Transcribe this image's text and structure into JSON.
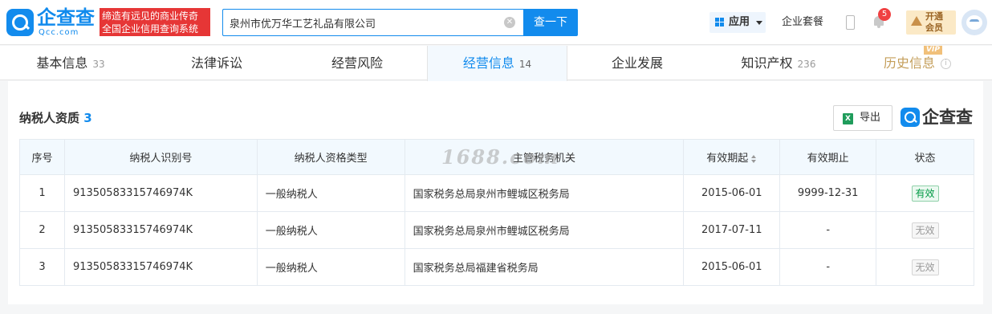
{
  "header": {
    "logo": {
      "name": "企查查",
      "domain": "Qcc.com"
    },
    "slogan": [
      "缔造有远见的商业传奇",
      "全国企业信用查询系统"
    ],
    "search": {
      "value": "泉州市优万华工艺礼品有限公司",
      "button": "查一下"
    },
    "apps_label": "应用",
    "suite_label": "企业套餐",
    "notification_count": "5",
    "vip": {
      "line1": "开通",
      "line2": "会员"
    }
  },
  "tabs": [
    {
      "label": "基本信息",
      "count": "33"
    },
    {
      "label": "法律诉讼",
      "count": ""
    },
    {
      "label": "经营风险",
      "count": ""
    },
    {
      "label": "经营信息",
      "count": "14",
      "active": true
    },
    {
      "label": "企业发展",
      "count": ""
    },
    {
      "label": "知识产权",
      "count": "236"
    },
    {
      "label": "历史信息",
      "count": "",
      "tag": "VIP"
    }
  ],
  "section": {
    "title": "纳税人资质",
    "count": "3",
    "export_label": "导出",
    "brand": "企查查"
  },
  "table": {
    "headers": [
      "序号",
      "纳税人识别号",
      "纳税人资格类型",
      "主管税务机关",
      "有效期起",
      "有效期止",
      "状态"
    ],
    "rows": [
      {
        "no": "1",
        "tax_id": "91350583315746974K",
        "type": "一般纳税人",
        "authority": "国家税务总局泉州市鲤城区税务局",
        "start": "2015-06-01",
        "end": "9999-12-31",
        "status": "有效",
        "valid": true
      },
      {
        "no": "2",
        "tax_id": "91350583315746974K",
        "type": "一般纳税人",
        "authority": "国家税务总局泉州市鲤城区税务局",
        "start": "2017-07-11",
        "end": "-",
        "status": "无效",
        "valid": false
      },
      {
        "no": "3",
        "tax_id": "91350583315746974K",
        "type": "一般纳税人",
        "authority": "国家税务总局福建省税务局",
        "start": "2015-06-01",
        "end": "-",
        "status": "无效",
        "valid": false
      }
    ]
  },
  "watermark": "1688.com",
  "colors": {
    "brand": "#128bed",
    "slogan_bg": "#e63636",
    "valid": "#009944",
    "vip": "#c49e5a"
  }
}
